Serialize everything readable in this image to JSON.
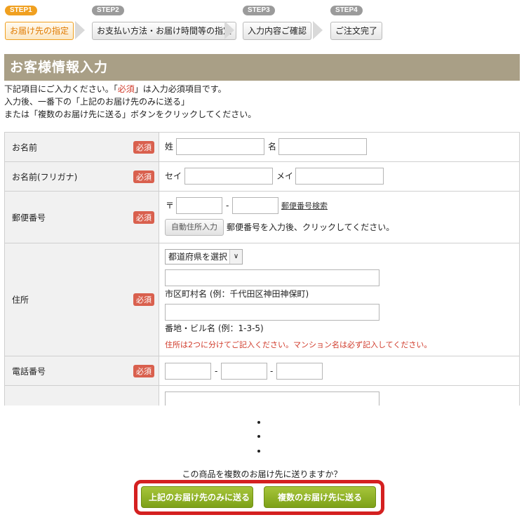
{
  "steps": [
    {
      "badge": "STEP1",
      "label": "お届け先の指定"
    },
    {
      "badge": "STEP2",
      "label": "お支払い方法・お届け時間等の指定"
    },
    {
      "badge": "STEP3",
      "label": "入力内容ご確認"
    },
    {
      "badge": "STEP4",
      "label": "ご注文完了"
    }
  ],
  "title": "お客様情報入力",
  "intro": {
    "line1_a": "下記項目にご入力ください。「",
    "line1_req": "必須",
    "line1_b": "」は入力必須項目です。",
    "line2": "入力後、一番下の「上記のお届け先のみに送る」",
    "line3": "または「複数のお届け先に送る」ボタンをクリックしてください。"
  },
  "required_badge": "必須",
  "form": {
    "name": {
      "label": "お名前",
      "last": "姓",
      "first": "名"
    },
    "kana": {
      "label": "お名前(フリガナ)",
      "last": "セイ",
      "first": "メイ"
    },
    "postal": {
      "label": "郵便番号",
      "mark": "〒",
      "dash": "-",
      "search_link": "郵便番号検索",
      "auto_button": "自動住所入力",
      "hint": "郵便番号を入力後、クリックしてください。"
    },
    "address": {
      "label": "住所",
      "prefecture_select": "都道府県を選択",
      "city_hint": "市区町村名 (例：千代田区神田神保町)",
      "street_hint": "番地・ビル名 (例：1-3-5)",
      "note": "住所は2つに分けてご記入ください。マンション名は必ず記入してください。"
    },
    "phone": {
      "label": "電話番号",
      "dash": "-"
    }
  },
  "question": "この商品を複数のお届け先に送りますか？",
  "buttons": {
    "single": "上記のお届け先のみに送る",
    "multiple": "複数のお届け先に送る"
  },
  "colors": {
    "accent": "#f0a020",
    "title_bar": "#a99f86",
    "required": "#d9604e",
    "button_green": "#8fb12a",
    "highlight": "#d42020"
  }
}
